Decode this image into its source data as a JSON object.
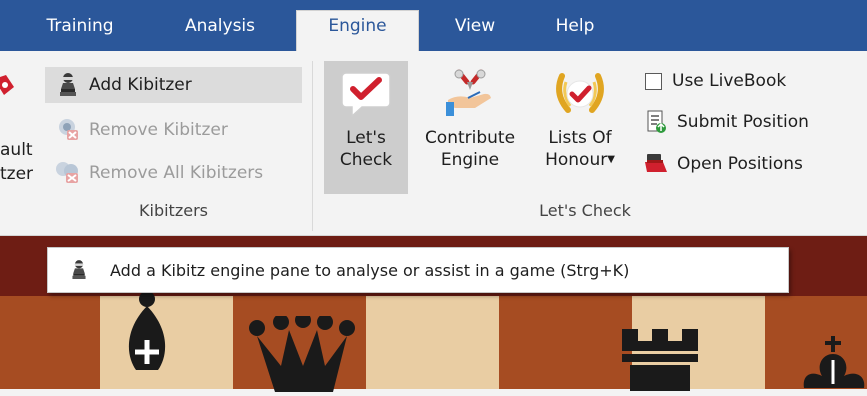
{
  "menu": {
    "tabs": [
      {
        "label": "Training"
      },
      {
        "label": "Analysis"
      },
      {
        "label": "Engine",
        "active": true
      },
      {
        "label": "View"
      },
      {
        "label": "Help"
      }
    ]
  },
  "ribbon": {
    "left_cut": {
      "line1": "ault",
      "line2": "tzer"
    },
    "kibitzers": {
      "add": "Add Kibitzer",
      "remove": "Remove Kibitzer",
      "remove_all": "Remove All Kibitzers",
      "group_label": "Kibitzers"
    },
    "lets_check": {
      "check": {
        "line1": "Let's",
        "line2": "Check"
      },
      "contribute": {
        "line1": "Contribute",
        "line2": "Engine"
      },
      "honour": {
        "line1": "Lists Of",
        "line2": "Honour"
      },
      "use_livebook": "Use LiveBook",
      "submit_position": "Submit Position",
      "open_positions": "Open Positions",
      "group_label": "Let's Check"
    }
  },
  "tooltip": {
    "text": "Add a Kibitz engine pane to analyse or assist in a game (Strg+K)"
  },
  "colors": {
    "ribbon_blue": "#2b579a",
    "check_red": "#d0202e",
    "board_light": "#e8cba0",
    "board_dark": "#a44a22"
  },
  "icons": {
    "kibitzer": "kibitzer-icon",
    "check": "lets-check-icon",
    "contribute": "contribute-engine-icon",
    "honour": "lists-of-honour-icon",
    "submit": "submit-position-icon",
    "open": "open-positions-icon"
  }
}
